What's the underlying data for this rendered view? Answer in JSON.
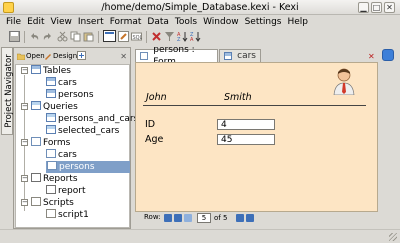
{
  "window": {
    "title": "/home/demo/Simple_Database.kexi - Kexi",
    "minimize": "▁",
    "maximize": "□",
    "close": "✕"
  },
  "menu": [
    "File",
    "Edit",
    "View",
    "Insert",
    "Format",
    "Data",
    "Tools",
    "Window",
    "Settings",
    "Help"
  ],
  "navigator": {
    "vertical_tab": "Project Navigator",
    "open_label": "Open",
    "design_label": "Design",
    "groups": [
      {
        "label": "Tables",
        "items": [
          "cars",
          "persons"
        ]
      },
      {
        "label": "Queries",
        "items": [
          "persons_and_cars",
          "selected_cars"
        ]
      },
      {
        "label": "Forms",
        "items": [
          "cars",
          "persons"
        ]
      },
      {
        "label": "Reports",
        "items": [
          "report"
        ]
      },
      {
        "label": "Scripts",
        "items": [
          "script1"
        ]
      }
    ],
    "selected": "persons"
  },
  "tabs": [
    {
      "label": "persons : Form",
      "active": true
    },
    {
      "label": "cars",
      "active": false
    }
  ],
  "form": {
    "first_name": "John",
    "last_name": "Smith",
    "fields": [
      {
        "label": "ID",
        "value": "4"
      },
      {
        "label": "Age",
        "value": "45"
      }
    ],
    "background": "#fde5c4"
  },
  "record_nav": {
    "label": "Row:",
    "current": "5",
    "of_text": "of 5"
  },
  "colors": {
    "selection": "#7f9fc8",
    "accent": "#3d6fb8"
  }
}
